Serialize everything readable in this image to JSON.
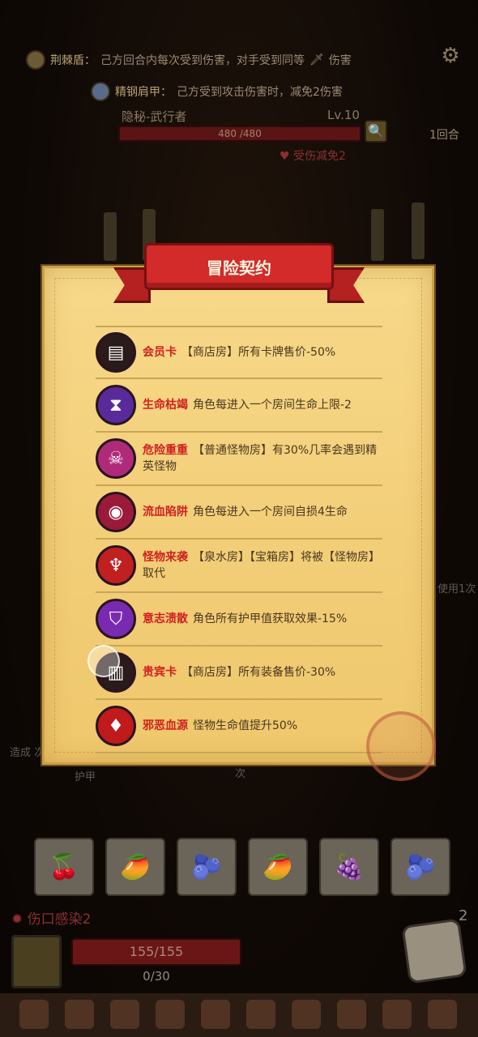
{
  "top": {
    "buff1": {
      "name": "荆棘盾：",
      "desc": "己方回合内每次受到伤害，对手受到同等",
      "suffix": "伤害"
    },
    "buff2": {
      "name": "精钢肩甲：",
      "desc": "己方受到攻击伤害时，减免2伤害"
    },
    "enemy_name": "隐秘-武行者",
    "enemy_level": "Lv.10",
    "enemy_hp": "480 /480",
    "round": "1回合",
    "damage_reduce": "受伤减免2"
  },
  "dialog": {
    "title": "冒险契约",
    "items": [
      {
        "name": "会员卡",
        "desc": "【商店房】所有卡牌售价-50%",
        "icon": "membership-card-icon",
        "color": "#2a1a1a"
      },
      {
        "name": "生命枯竭",
        "desc": "角色每进入一个房间生命上限-2",
        "icon": "hourglass-icon",
        "color": "#5a2a9a"
      },
      {
        "name": "危险重重",
        "desc": "【普通怪物房】有30%几率会遇到精英怪物",
        "icon": "skull-icon",
        "color": "#b02a7a"
      },
      {
        "name": "流血陷阱",
        "desc": "角色每进入一个房间自损4生命",
        "icon": "fang-trap-icon",
        "color": "#9a1a3a"
      },
      {
        "name": "怪物来袭",
        "desc": "【泉水房】【宝箱房】将被【怪物房】取代",
        "icon": "demon-icon",
        "color": "#c02020"
      },
      {
        "name": "意志溃散",
        "desc": "角色所有护甲值获取效果-15%",
        "icon": "broken-shield-icon",
        "color": "#7a2ab0"
      },
      {
        "name": "贵宾卡",
        "desc": "【商店房】所有装备售价-30%",
        "icon": "vip-card-icon",
        "color": "#2a1a1a"
      },
      {
        "name": "邪恶血源",
        "desc": "怪物生命值提升50%",
        "icon": "blood-bag-icon",
        "color": "#c01a1a"
      }
    ]
  },
  "bottom": {
    "side_left": "造成 次造成",
    "side_left2": "护甲",
    "side_mid": "次",
    "side_right": "使用1次",
    "wound": "伤口感染2",
    "player_hp": "155/155",
    "player_armor": "0/30",
    "dice_count": "2",
    "fruits": [
      "🍒",
      "🥭",
      "🫐",
      "🥭",
      "🍇",
      "🫐"
    ]
  }
}
